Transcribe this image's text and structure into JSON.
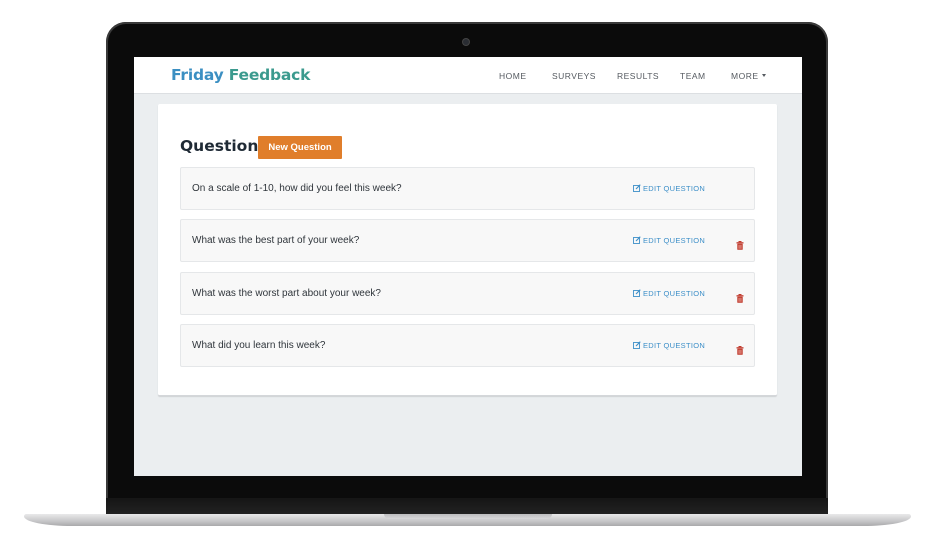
{
  "app": {
    "brand_part1": "Friday",
    "brand_part2": "Feedback",
    "brand_color_1": "#3b8fc2",
    "brand_color_2": "#3b9a8e"
  },
  "nav": {
    "items": [
      {
        "label": "HOME"
      },
      {
        "label": "SURVEYS"
      },
      {
        "label": "RESULTS"
      },
      {
        "label": "TEAM"
      },
      {
        "label": "MORE",
        "icon": "caret-down-icon"
      }
    ]
  },
  "main": {
    "title": "Questions",
    "new_button_label": "New Question",
    "accent_color": "#e07e2b",
    "questions": [
      {
        "text": "On a scale of 1-10, how did you feel this week?",
        "edit_label": "EDIT QUESTION",
        "deletable": false
      },
      {
        "text": "What was the best part of your week?",
        "edit_label": "EDIT QUESTION",
        "deletable": true
      },
      {
        "text": "What was the worst part about your week?",
        "edit_label": "EDIT QUESTION",
        "deletable": true
      },
      {
        "text": "What did you learn this week?",
        "edit_label": "EDIT QUESTION",
        "deletable": true
      }
    ],
    "edit_icon": "edit-icon",
    "delete_icon": "trash-icon",
    "delete_color": "#c0392b"
  }
}
